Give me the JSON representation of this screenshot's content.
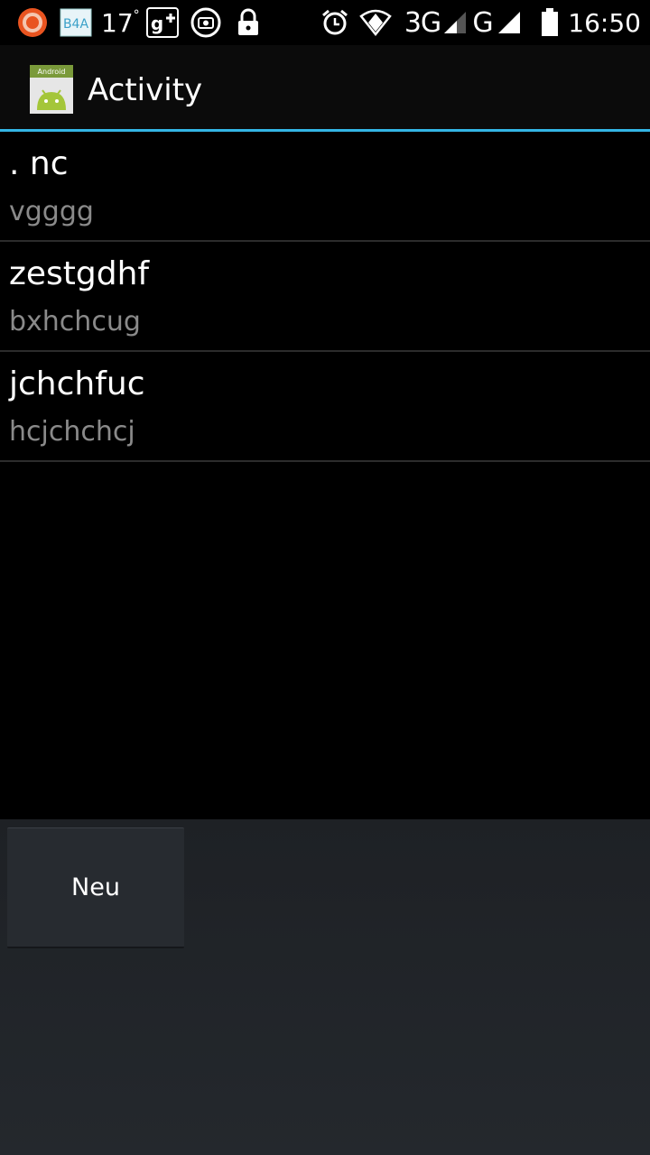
{
  "status_bar": {
    "temperature": "17",
    "degree": "°",
    "b4a_label": "B4A",
    "network_3g": "3G",
    "network_g": "G",
    "time": "16:50",
    "icons": [
      "ubuntu-icon",
      "b4a-icon",
      "google-plus-icon",
      "camera-icon",
      "lock-icon",
      "alarm-icon",
      "wifi-icon",
      "signal-icon",
      "battery-icon"
    ]
  },
  "action_bar": {
    "title": "Activity",
    "icon_label": "Android",
    "divider_color": "#33b5e5"
  },
  "list": {
    "items": [
      {
        "title": ". nc",
        "subtitle": "vgggg"
      },
      {
        "title": "zestgdhf",
        "subtitle": "bxhchcug"
      },
      {
        "title": "jchchfuc",
        "subtitle": "hcjchchcj"
      }
    ]
  },
  "buttons": {
    "new_label": "Neu"
  }
}
